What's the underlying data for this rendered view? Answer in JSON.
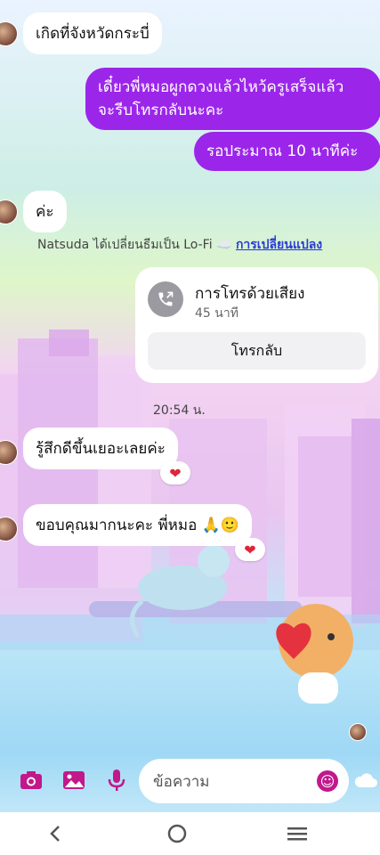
{
  "messages": {
    "in1": "เกิดที่จังหวัดกระบี่",
    "out1_line1": "เดี๋ยวพี่หมอผูกดวงแล้วไหว้ครูเสร็จแล้ว",
    "out1_line2": "จะรีบโทรกลับนะคะ",
    "out2": "รอประมาณ 10 นาทีค่ะ",
    "in2": "ค่ะ",
    "in3": "รู้สึกดีขึ้นเยอะเลยค่ะ",
    "in4": "ขอบคุณมากนะคะ พี่หมอ 🙏🙂"
  },
  "theme_notice": {
    "text": "Natsuda ได้เปลี่ยนธีมเป็น Lo-Fi ☁️ ",
    "link": "การเปลี่ยนแปลง"
  },
  "call": {
    "title": "การโทรด้วยเสียง",
    "duration": "45 นาที",
    "call_back": "โทรกลับ"
  },
  "timestamp": "20:54 น.",
  "reactions": {
    "r1": "❤",
    "r2": "❤"
  },
  "composer": {
    "placeholder": "ข้อความ"
  },
  "icons": {
    "camera": "camera-icon",
    "gallery": "image-icon",
    "mic": "microphone-icon",
    "emoji": "emoji-icon",
    "like": "cloud-icon"
  },
  "colors": {
    "accent": "#9b26ea",
    "icon": "#c2188c"
  }
}
